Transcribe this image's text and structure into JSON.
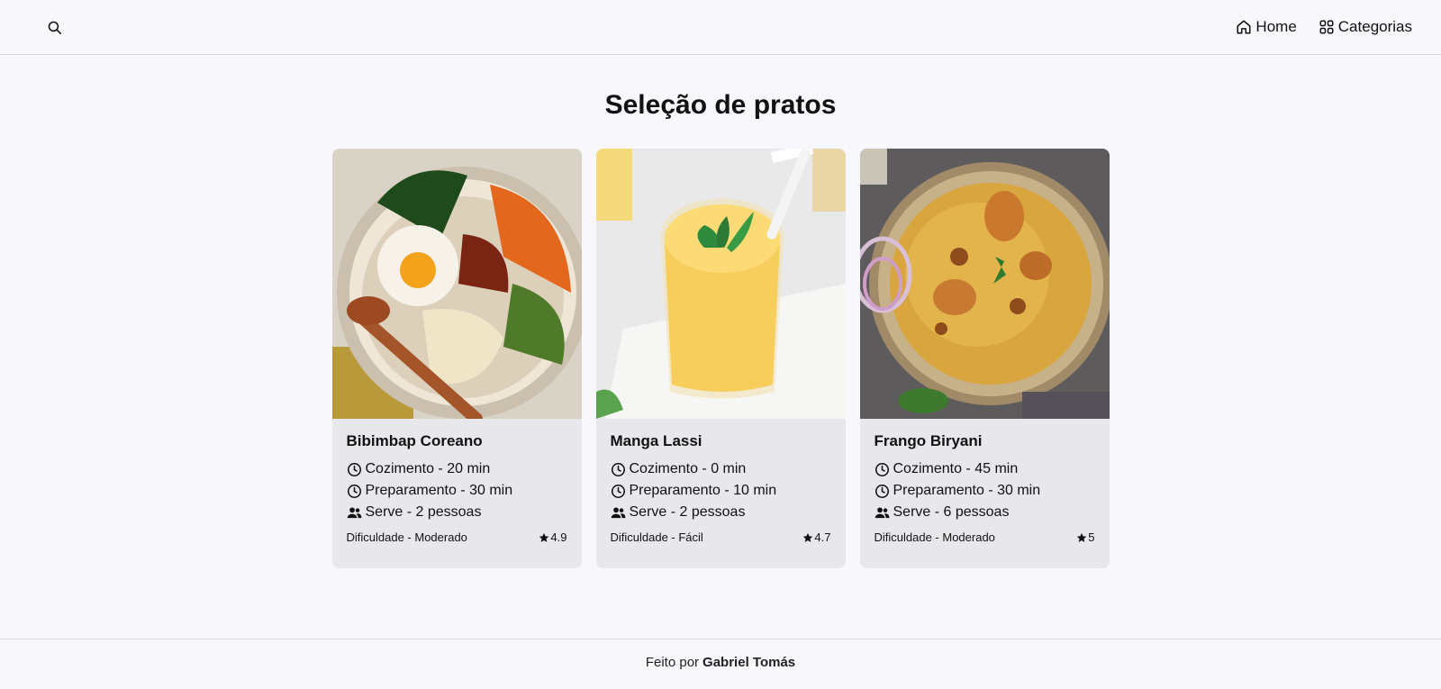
{
  "header": {
    "nav": [
      {
        "label": "Home",
        "icon": "home-icon"
      },
      {
        "label": "Categorias",
        "icon": "grid-icon"
      }
    ]
  },
  "main": {
    "title": "Seleção de pratos",
    "cards": [
      {
        "name": "Bibimbap Coreano",
        "cook": "Cozimento - 20 min",
        "prep": "Preparamento - 30 min",
        "serves": "Serve - 2 pessoas",
        "difficulty": "Dificuldade - Moderado",
        "rating": "4.9",
        "image": "bibimbap-bowl-photo"
      },
      {
        "name": "Manga Lassi",
        "cook": "Cozimento - 0 min",
        "prep": "Preparamento - 10 min",
        "serves": "Serve - 2 pessoas",
        "difficulty": "Dificuldade - Fácil",
        "rating": "4.7",
        "image": "mango-lassi-glass-photo"
      },
      {
        "name": "Frango Biryani",
        "cook": "Cozimento - 45 min",
        "prep": "Preparamento - 30 min",
        "serves": "Serve - 6 pessoas",
        "difficulty": "Dificuldade - Moderado",
        "rating": "5",
        "image": "chicken-biryani-plate-photo"
      }
    ]
  },
  "footer": {
    "prefix": "Feito por",
    "author": "Gabriel Tomás"
  }
}
